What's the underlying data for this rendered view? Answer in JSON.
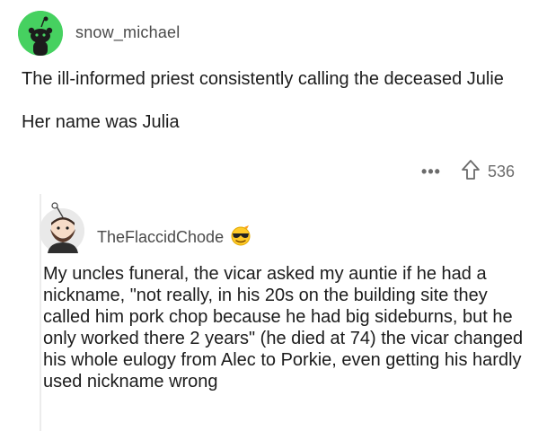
{
  "parent_comment": {
    "username": "snow_michael",
    "avatar_icon": "reddit-snoo-icon",
    "avatar_color": "#46d160",
    "paragraphs": [
      "The ill-informed priest consistently calling the deceased Julie",
      "Her name was Julia"
    ],
    "more_label": "•••",
    "upvote_icon": "upvote-arrow-icon",
    "vote_count": "536"
  },
  "reply_comment": {
    "username": "TheFlaccidChode",
    "avatar_icon": "bearded-snoo-avatar-icon",
    "flair_icon": "cool-sunglasses-emoji-icon",
    "text": "My uncles funeral, the vicar asked my auntie if he had a nickname, \"not really, in his 20s on the building site they called him pork chop because he had big sideburns, but he only worked there 2 years\" (he died at 74) the vicar changed his whole eulogy from Alec to Porkie, even getting his hardly used nickname wrong"
  }
}
